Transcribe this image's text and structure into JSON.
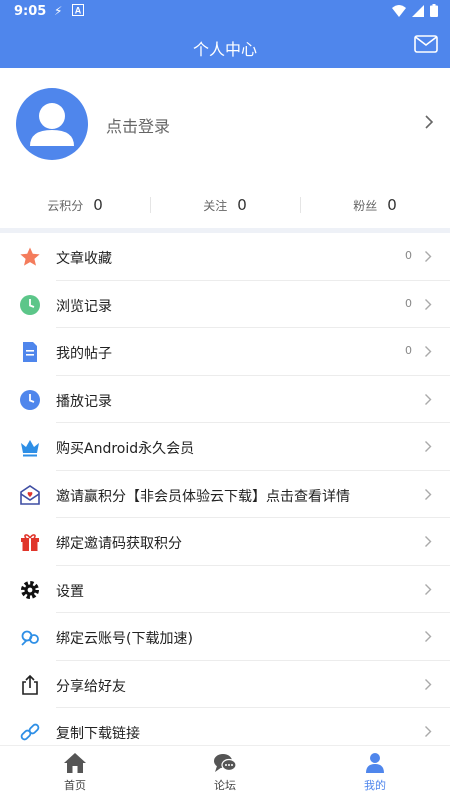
{
  "status_bar": {
    "time": "9:05"
  },
  "header": {
    "title": "个人中心",
    "mail_icon": "mail-icon"
  },
  "profile": {
    "login_text": "点击登录"
  },
  "stats": [
    {
      "label": "云积分",
      "value": "0"
    },
    {
      "label": "关注",
      "value": "0"
    },
    {
      "label": "粉丝",
      "value": "0"
    }
  ],
  "menu": [
    {
      "label": "文章收藏",
      "count": "0",
      "icon": "star-icon"
    },
    {
      "label": "浏览记录",
      "count": "0",
      "icon": "clock-icon"
    },
    {
      "label": "我的帖子",
      "count": "0",
      "icon": "document-icon"
    },
    {
      "label": "播放记录",
      "count": "",
      "icon": "play-history-icon"
    },
    {
      "label": "购买Android永久会员",
      "count": "",
      "icon": "crown-icon"
    },
    {
      "label": "邀请赢积分【非会员体验云下载】点击查看详情",
      "count": "",
      "icon": "invite-icon"
    },
    {
      "label": "绑定邀请码获取积分",
      "count": "",
      "icon": "gift-icon"
    },
    {
      "label": "设置",
      "count": "",
      "icon": "gear-icon"
    },
    {
      "label": "绑定云账号(下载加速)",
      "count": "",
      "icon": "cloud-link-icon"
    },
    {
      "label": "分享给好友",
      "count": "",
      "icon": "share-icon"
    },
    {
      "label": "复制下载链接",
      "count": "",
      "icon": "link-icon"
    }
  ],
  "tabs": [
    {
      "label": "首页",
      "icon": "home-icon"
    },
    {
      "label": "论坛",
      "icon": "forum-icon"
    },
    {
      "label": "我的",
      "icon": "profile-icon"
    }
  ],
  "colors": {
    "accent": "#4f86ec",
    "star": "#f47c5c",
    "clock": "#5cc689",
    "crown": "#2e8fe6",
    "gift": "#e0352b"
  }
}
